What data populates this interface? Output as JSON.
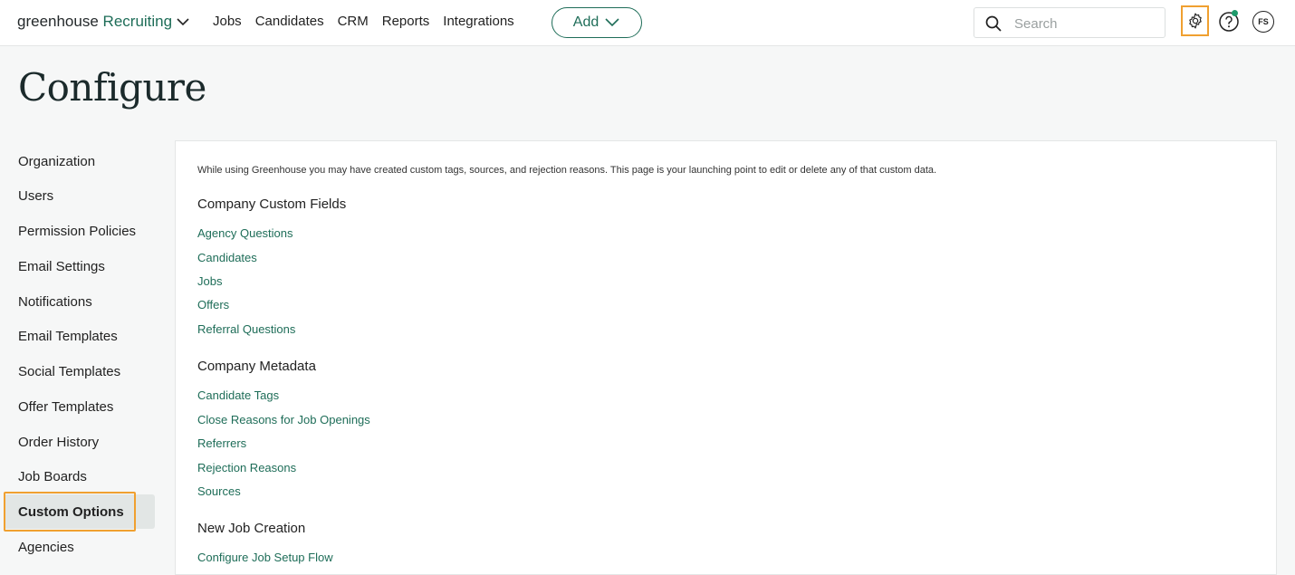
{
  "header": {
    "logo_brand": "greenhouse",
    "logo_product": "Recruiting",
    "nav": [
      "Jobs",
      "Candidates",
      "CRM",
      "Reports",
      "Integrations"
    ],
    "add_label": "Add",
    "search_placeholder": "Search",
    "avatar_initials": "FS",
    "icons": {
      "settings": "gear-icon",
      "help": "help-icon",
      "search": "search-icon"
    },
    "accent_color": "#1e6d58",
    "highlight_color": "#f0a030"
  },
  "page": {
    "title": "Configure"
  },
  "sidebar": {
    "items": [
      {
        "label": "Organization"
      },
      {
        "label": "Users"
      },
      {
        "label": "Permission Policies"
      },
      {
        "label": "Email Settings"
      },
      {
        "label": "Notifications"
      },
      {
        "label": "Email Templates"
      },
      {
        "label": "Social Templates"
      },
      {
        "label": "Offer Templates"
      },
      {
        "label": "Order History"
      },
      {
        "label": "Job Boards"
      },
      {
        "label": "Custom Options",
        "active": true
      },
      {
        "label": "Agencies"
      }
    ]
  },
  "main": {
    "intro": "While using Greenhouse you may have created custom tags, sources, and rejection reasons. This page is your launching point to edit or delete any of that custom data.",
    "sections": [
      {
        "title": "Company Custom Fields",
        "links": [
          "Agency Questions",
          "Candidates",
          "Jobs",
          "Offers",
          "Referral Questions"
        ]
      },
      {
        "title": "Company Metadata",
        "links": [
          "Candidate Tags",
          "Close Reasons for Job Openings",
          "Referrers",
          "Rejection Reasons",
          "Sources"
        ]
      },
      {
        "title": "New Job Creation",
        "links": [
          "Configure Job Setup Flow"
        ]
      }
    ]
  }
}
